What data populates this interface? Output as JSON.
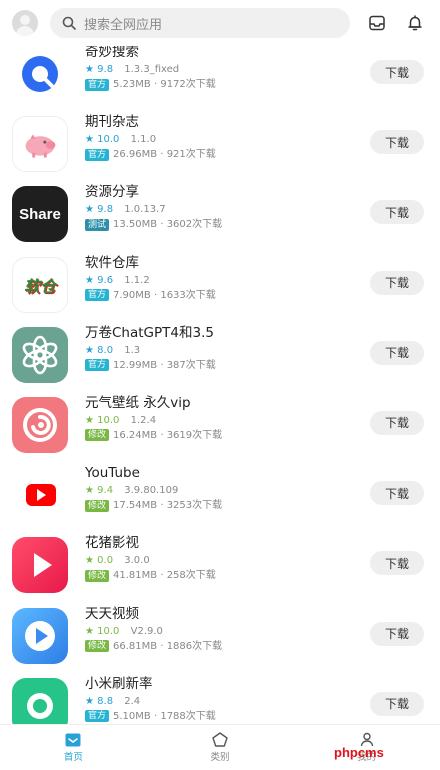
{
  "header": {
    "search_placeholder": "搜索全网应用",
    "avatar_icon": "user-avatar-icon",
    "inbox_icon": "inbox-icon",
    "bell_icon": "bell-icon"
  },
  "apps": [
    {
      "name": "奇妙搜索",
      "rating": "9.8",
      "version": "1.3.3_fixed",
      "badge": "官方",
      "badge_color": "#26b4d2",
      "size": "5.23MB",
      "downloads": "9172次下载",
      "button": "下载",
      "star_color": "blue",
      "icon": "search-app-icon"
    },
    {
      "name": "期刊杂志",
      "rating": "10.0",
      "version": "1.1.0",
      "badge": "官方",
      "badge_color": "#26b4d2",
      "size": "26.96MB",
      "downloads": "921次下载",
      "button": "下载",
      "star_color": "blue",
      "icon": "pig-icon"
    },
    {
      "name": "资源分享",
      "rating": "9.8",
      "version": "1.0.13.7",
      "badge": "测试",
      "badge_color": "#2f8fa8",
      "size": "13.50MB",
      "downloads": "3602次下载",
      "button": "下载",
      "star_color": "blue",
      "icon": "share-icon",
      "icon_text": "Share"
    },
    {
      "name": "软件仓库",
      "rating": "9.6",
      "version": "1.1.2",
      "badge": "官方",
      "badge_color": "#26b4d2",
      "size": "7.90MB",
      "downloads": "1633次下载",
      "button": "下载",
      "star_color": "blue",
      "icon": "software-store-icon",
      "icon_text": "软仓"
    },
    {
      "name": "万卷ChatGPT4和3.5",
      "rating": "8.0",
      "version": "1.3",
      "badge": "官方",
      "badge_color": "#26b4d2",
      "size": "12.99MB",
      "downloads": "387次下载",
      "button": "下载",
      "star_color": "blue",
      "icon": "openai-icon"
    },
    {
      "name": "元气壁纸 永久vip",
      "rating": "10.0",
      "version": "1.2.4",
      "badge": "修改",
      "badge_color": "#7ab845",
      "size": "16.24MB",
      "downloads": "3619次下载",
      "button": "下载",
      "star_color": "green",
      "icon": "wallpaper-icon"
    },
    {
      "name": "YouTube",
      "rating": "9.4",
      "version": "3.9.80.109",
      "badge": "修改",
      "badge_color": "#7ab845",
      "size": "17.54MB",
      "downloads": "3253次下载",
      "button": "下载",
      "star_color": "green",
      "icon": "youtube-icon"
    },
    {
      "name": "花猪影视",
      "rating": "0.0",
      "version": "3.0.0",
      "badge": "修改",
      "badge_color": "#7ab845",
      "size": "41.81MB",
      "downloads": "258次下载",
      "button": "下载",
      "star_color": "green",
      "icon": "play-icon"
    },
    {
      "name": "天天视频",
      "rating": "10.0",
      "version": "V2.9.0",
      "badge": "修改",
      "badge_color": "#7ab845",
      "size": "66.81MB",
      "downloads": "1886次下载",
      "button": "下载",
      "star_color": "green",
      "icon": "video-play-icon"
    },
    {
      "name": "小米刷新率",
      "rating": "8.8",
      "version": "2.4",
      "badge": "官方",
      "badge_color": "#26b4d2",
      "size": "5.10MB",
      "downloads": "1788次下载",
      "button": "下载",
      "star_color": "blue",
      "icon": "refresh-rate-icon"
    }
  ],
  "nav": [
    {
      "label": "首页",
      "icon": "home-icon",
      "active": true
    },
    {
      "label": "类别",
      "icon": "category-icon",
      "active": false
    },
    {
      "label": "我的",
      "icon": "profile-icon",
      "active": false
    }
  ],
  "watermark": "phpcms",
  "colors": {
    "accent": "#2aa1d6",
    "green": "#7ab845",
    "button_bg": "#eeeeee"
  }
}
